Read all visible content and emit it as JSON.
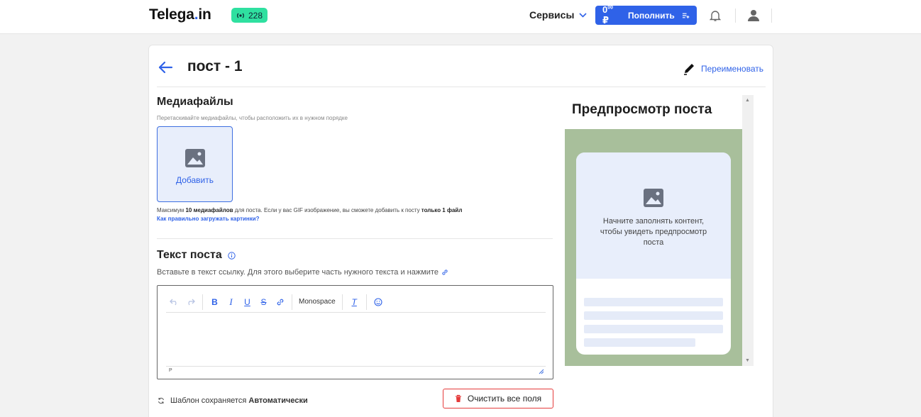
{
  "header": {
    "logo_main": "Telega",
    "logo_dot": ".",
    "logo_tail": "in",
    "badge_count": "228",
    "services_label": "Сервисы",
    "balance_value": "0",
    "balance_cents": "00",
    "currency": "₽",
    "topup_label": "Пополнить"
  },
  "page": {
    "title": "пост - 1",
    "rename_label": "Переименовать"
  },
  "media": {
    "heading": "Медиафайлы",
    "hint": "Перетаскивайте медиафайлы, чтобы расположить их в нужном порядке",
    "add_label": "Добавить",
    "max_prefix": "Максимум ",
    "max_bold": "10 медиафайлов",
    "max_middle": " для поста. Если у вас GIF изображение, вы сможете добавить к посту ",
    "max_bold2": "только 1 файл",
    "help_link": "Как правильно загружать картинки?"
  },
  "post_text": {
    "heading": "Текст поста",
    "hint": "Вставьте в текст ссылку. Для этого выберите часть нужного текста и нажмите",
    "toolbar": {
      "bold": "B",
      "italic": "I",
      "underline": "U",
      "strike": "S",
      "monospace": "Monospace",
      "clear_format": "T"
    },
    "status_path": "P"
  },
  "footer": {
    "autosave_prefix": "Шаблон сохраняется ",
    "autosave_bold": "Автоматически",
    "clear_label": "Очистить все поля"
  },
  "preview": {
    "heading": "Предпросмотр поста",
    "placeholder": "Начните заполнять контент, чтобы увидеть предпросмотр поста"
  },
  "colors": {
    "accent": "#2f62e8",
    "badge": "#2fe0a0",
    "danger": "#e53b3b",
    "preview_bg": "#a8bf9b"
  }
}
